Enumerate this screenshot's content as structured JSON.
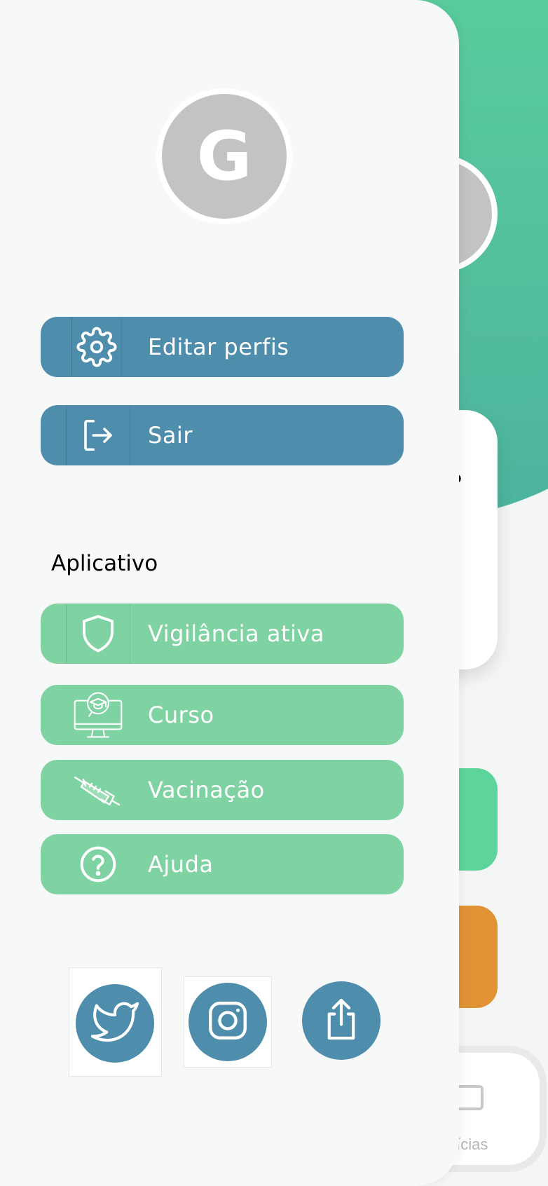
{
  "profile": {
    "avatar_letter": "G"
  },
  "account_actions": [
    {
      "label": "Editar perfis",
      "icon": "gear-icon"
    },
    {
      "label": "Sair",
      "icon": "logout-icon"
    }
  ],
  "app_section": {
    "title": "Aplicativo",
    "items": [
      {
        "label": "Vigilância ativa",
        "icon": "shield-icon"
      },
      {
        "label": "Curso",
        "icon": "online-course-icon"
      },
      {
        "label": "Vacinação",
        "icon": "syringe-icon"
      },
      {
        "label": "Ajuda",
        "icon": "help-icon"
      }
    ]
  },
  "social": [
    {
      "name": "twitter",
      "icon": "twitter-icon"
    },
    {
      "name": "instagram",
      "icon": "instagram-icon"
    },
    {
      "name": "share",
      "icon": "share-icon"
    }
  ],
  "background_app": {
    "card_fragment": "?",
    "tab_label_fragment": "tícias"
  },
  "colors": {
    "primary_blue": "#4e8dab",
    "menu_green": "#7fd2a2",
    "hero_green": "#5ed49b",
    "accent_orange": "#e19234",
    "avatar_gray": "#c3c3c3"
  }
}
